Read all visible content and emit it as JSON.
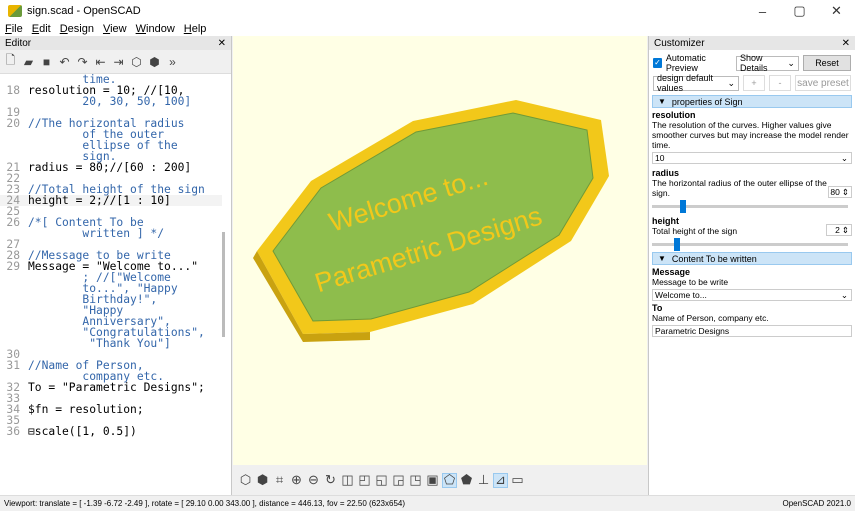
{
  "window": {
    "title": "sign.scad - OpenSCAD",
    "minimize": "–",
    "maximize": "▢",
    "close": "✕"
  },
  "menu": [
    "File",
    "Edit",
    "Design",
    "View",
    "Window",
    "Help"
  ],
  "editor": {
    "title": "Editor",
    "close": "✕",
    "lines": [
      {
        "n": "",
        "t": "        time.",
        "c": "cm"
      },
      {
        "n": "18",
        "t": "resolution = 10; //[10,",
        "c": "tx"
      },
      {
        "n": "",
        "t": "        20, 30, 50, 100]",
        "c": "cm"
      },
      {
        "n": "19",
        "t": "",
        "c": "tx"
      },
      {
        "n": "20",
        "t": "//The horizontal radius",
        "c": "cm"
      },
      {
        "n": "",
        "t": "        of the outer",
        "c": "cm"
      },
      {
        "n": "",
        "t": "        ellipse of the",
        "c": "cm"
      },
      {
        "n": "",
        "t": "        sign.",
        "c": "cm"
      },
      {
        "n": "21",
        "t": "radius = 80;//[60 : 200]",
        "c": "tx"
      },
      {
        "n": "22",
        "t": "",
        "c": "tx"
      },
      {
        "n": "23",
        "t": "//Total height of the sign",
        "c": "cm"
      },
      {
        "n": "24",
        "t": "height = 2;//[1 : 10]",
        "c": "tx",
        "hl": true
      },
      {
        "n": "25",
        "t": "",
        "c": "tx"
      },
      {
        "n": "26",
        "t": "/*[ Content To be",
        "c": "cm"
      },
      {
        "n": "",
        "t": "        written ] */",
        "c": "cm"
      },
      {
        "n": "27",
        "t": "",
        "c": "tx"
      },
      {
        "n": "28",
        "t": "//Message to be write",
        "c": "cm"
      },
      {
        "n": "29",
        "t": "Message = \"Welcome to...\"",
        "c": "tx"
      },
      {
        "n": "",
        "t": "        ; //[\"Welcome",
        "c": "cm"
      },
      {
        "n": "",
        "t": "        to...\", \"Happy",
        "c": "cm"
      },
      {
        "n": "",
        "t": "        Birthday!\",",
        "c": "cm"
      },
      {
        "n": "",
        "t": "        \"Happy",
        "c": "cm"
      },
      {
        "n": "",
        "t": "        Anniversary\",",
        "c": "cm"
      },
      {
        "n": "",
        "t": "        \"Congratulations\",",
        "c": "cm"
      },
      {
        "n": "",
        "t": "         \"Thank You\"]",
        "c": "cm"
      },
      {
        "n": "30",
        "t": "",
        "c": "tx"
      },
      {
        "n": "31",
        "t": "//Name of Person,",
        "c": "cm"
      },
      {
        "n": "",
        "t": "        company etc.",
        "c": "cm"
      },
      {
        "n": "32",
        "t": "To = \"Parametric Designs\";",
        "c": "tx"
      },
      {
        "n": "33",
        "t": "",
        "c": "tx"
      },
      {
        "n": "34",
        "t": "$fn = resolution;",
        "c": "tx"
      },
      {
        "n": "35",
        "t": "",
        "c": "tx"
      },
      {
        "n": "36",
        "t": "⊟scale([1, 0.5])",
        "c": "tx"
      }
    ]
  },
  "viewport": {
    "sign_line1": "Welcome to...",
    "sign_line2": "Parametric Designs",
    "colors": {
      "bg": "#ffffe5",
      "rim": "#f2c81a",
      "face": "#8ebd4c",
      "text": "#f2c81a"
    }
  },
  "customizer": {
    "title": "Customizer",
    "close": "✕",
    "auto_preview_label": "Automatic Preview",
    "show_details": "Show Details",
    "reset": "Reset",
    "preset": "design default values",
    "add": "+",
    "remove": "-",
    "save_preset": "save preset",
    "sections": [
      {
        "title": "properties of Sign",
        "fields": [
          {
            "name": "resolution",
            "desc": "The resolution of the curves. Higher values give smoother curves but may increase the model render time.",
            "value": "10",
            "kind": "combo"
          },
          {
            "name": "radius",
            "desc": "The horizontal radius of the outer ellipse of the sign.",
            "value": "80",
            "kind": "slider",
            "fraction": 0.143
          },
          {
            "name": "height",
            "desc": "Total height of the sign",
            "value": "2",
            "kind": "slider",
            "fraction": 0.111
          }
        ]
      },
      {
        "title": "Content To be written",
        "fields": [
          {
            "name": "Message",
            "desc": "Message to be write",
            "value": "Welcome to...",
            "kind": "combo"
          },
          {
            "name": "To",
            "desc": "Name of Person, company etc.",
            "value": "Parametric Designs",
            "kind": "text"
          }
        ]
      }
    ]
  },
  "status": {
    "left": "Viewport: translate = [ -1.39 -6.72 -2.49 ], rotate = [ 29.10 0.00 343.00 ], distance = 446.13, fov = 22.50 (623x654)",
    "right": "OpenSCAD 2021.0"
  }
}
